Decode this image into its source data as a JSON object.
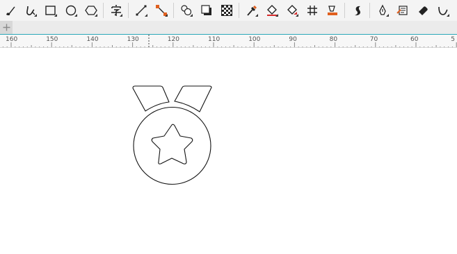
{
  "toolbar": {
    "tools": [
      {
        "name": "brush-icon",
        "group": 1
      },
      {
        "name": "pen-curve-icon",
        "group": 1
      },
      {
        "name": "rectangle-icon",
        "group": 1
      },
      {
        "name": "ellipse-icon",
        "group": 1
      },
      {
        "name": "polygon-icon",
        "group": 1
      },
      {
        "name": "text-tool-icon",
        "group": 2
      },
      {
        "name": "line-tool-icon",
        "group": 3
      },
      {
        "name": "connector-icon",
        "group": 3
      },
      {
        "name": "blend-icon",
        "group": 4
      },
      {
        "name": "shadow-icon",
        "group": 4
      },
      {
        "name": "transparency-icon",
        "group": 4
      },
      {
        "name": "eyedropper-icon",
        "group": 5
      },
      {
        "name": "fill-bucket-icon",
        "group": 5
      },
      {
        "name": "interactive-fill-icon",
        "group": 5
      },
      {
        "name": "mesh-fill-icon",
        "group": 5
      },
      {
        "name": "smart-fill-icon",
        "group": 5
      },
      {
        "name": "contour-icon",
        "group": 6
      },
      {
        "name": "pen-nib-icon",
        "group": 7
      },
      {
        "name": "edit-node-icon",
        "group": 7
      },
      {
        "name": "eraser-icon",
        "group": 7
      },
      {
        "name": "bezier-icon",
        "group": 7
      }
    ]
  },
  "tabs": {
    "add_label": "+"
  },
  "ruler": {
    "labels": [
      "160",
      "150",
      "140",
      "130",
      "120",
      "110",
      "100",
      "90",
      "80",
      "70",
      "60",
      "5"
    ]
  },
  "canvas": {
    "drawing": "medal-with-star-outline"
  }
}
